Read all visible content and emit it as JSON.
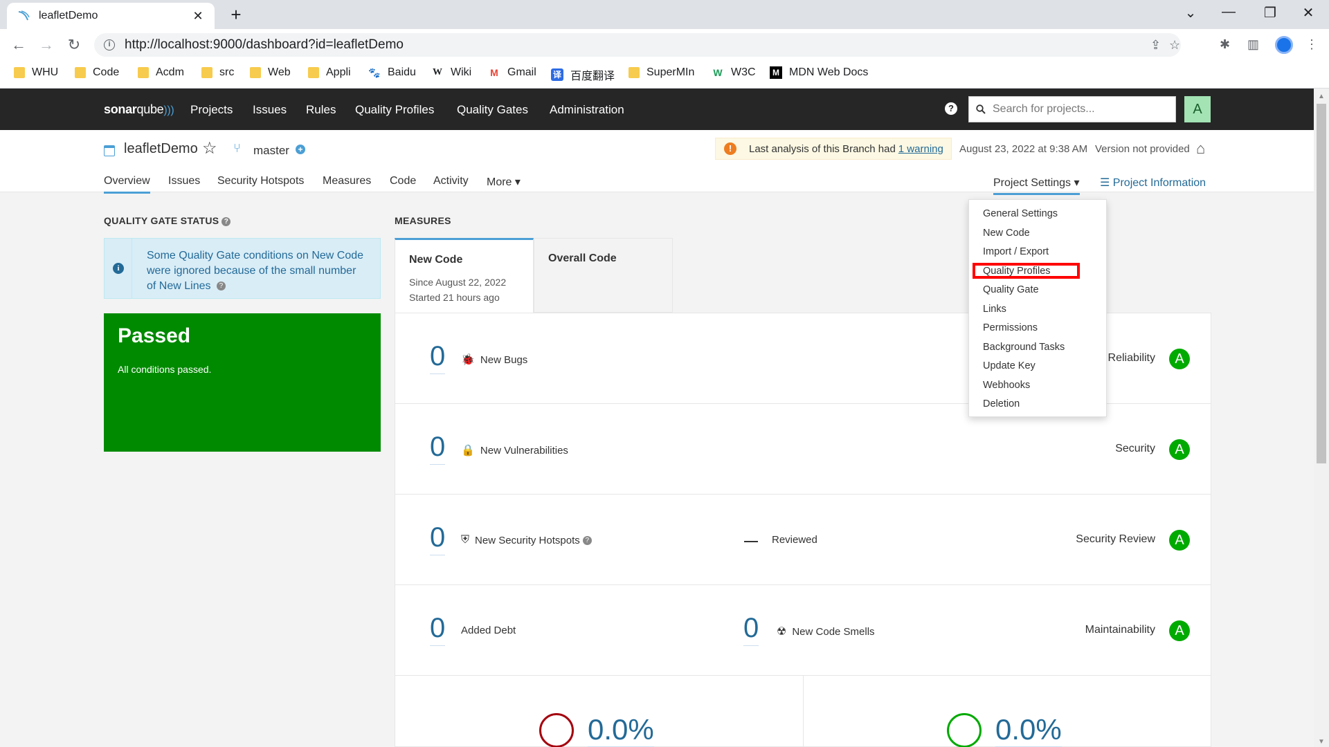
{
  "browser": {
    "tab_title": "leafletDemo",
    "tab_close": "✕",
    "new_tab": "+",
    "url": "http://localhost:9000/dashboard?id=leafletDemo",
    "bookmarks": [
      {
        "label": "WHU",
        "icon": "folder-icon"
      },
      {
        "label": "Code",
        "icon": "folder-icon"
      },
      {
        "label": "Acdm",
        "icon": "folder-icon"
      },
      {
        "label": "src",
        "icon": "folder-icon"
      },
      {
        "label": "Web",
        "icon": "folder-icon"
      },
      {
        "label": "Appli",
        "icon": "folder-icon"
      },
      {
        "label": "Baidu",
        "icon": "baidu-icon"
      },
      {
        "label": "Wiki",
        "icon": "wikipedia-icon"
      },
      {
        "label": "Gmail",
        "icon": "gmail-icon"
      },
      {
        "label": "百度翻译",
        "icon": "baidu-translate-icon"
      },
      {
        "label": "SuperMIn",
        "icon": "folder-icon"
      },
      {
        "label": "W3C",
        "icon": "w3c-icon"
      },
      {
        "label": "MDN Web Docs",
        "icon": "mdn-icon"
      }
    ]
  },
  "sonar": {
    "logo_bold": "sonar",
    "logo_light": "qube",
    "menu": [
      "Projects",
      "Issues",
      "Rules",
      "Quality Profiles",
      "Quality Gates",
      "Administration"
    ],
    "search_placeholder": "Search for projects...",
    "avatar_letter": "A",
    "help_glyph": "?"
  },
  "project": {
    "name": "leafletDemo",
    "branch": "master",
    "warning_text": "Last analysis of this Branch had",
    "warning_link": "1 warning",
    "analysis_date": "August 23, 2022 at 9:38 AM",
    "version": "Version not provided",
    "tabs": [
      "Overview",
      "Issues",
      "Security Hotspots",
      "Measures",
      "Code",
      "Activity",
      "More ▾"
    ],
    "settings_label": "Project Settings ▾",
    "info_label": "Project Information"
  },
  "quality_gate": {
    "title": "QUALITY GATE STATUS",
    "info_text": "Some Quality Gate conditions on New Code were ignored because of the small number of New Lines",
    "status": "Passed",
    "status_sub": "All conditions passed.",
    "status_color": "#008a00"
  },
  "measures": {
    "title": "MEASURES",
    "tab_new": {
      "title": "New Code",
      "line1": "Since August 22, 2022",
      "line2": "Started 21 hours ago"
    },
    "tab_overall": {
      "title": "Overall Code"
    },
    "rows": [
      {
        "value": "0",
        "label": "New Bugs",
        "icon": "bug-icon",
        "rating_label": "Reliability",
        "rating": "A"
      },
      {
        "value": "0",
        "label": "New Vulnerabilities",
        "icon": "lock-icon",
        "rating_label": "Security",
        "rating": "A"
      },
      {
        "value": "0",
        "label": "New Security Hotspots",
        "icon": "shield-icon",
        "reviewed_label": "Reviewed",
        "rating_label": "Security Review",
        "rating": "A"
      },
      {
        "value": "0",
        "label": "Added Debt",
        "value2": "0",
        "label2": "New Code Smells",
        "icon2": "code-smell-icon",
        "rating_label": "Maintainability",
        "rating": "A"
      }
    ],
    "coverage": {
      "left": "0.0%",
      "right": "0.0%",
      "left_color": "#a4030f",
      "right_color": "#00aa00"
    },
    "rating_color": "#00aa00"
  },
  "settings_menu": {
    "items": [
      "General Settings",
      "New Code",
      "Import / Export",
      "Quality Profiles",
      "Quality Gate",
      "Links",
      "Permissions",
      "Background Tasks",
      "Update Key",
      "Webhooks",
      "Deletion"
    ],
    "highlighted": "Quality Profiles"
  }
}
